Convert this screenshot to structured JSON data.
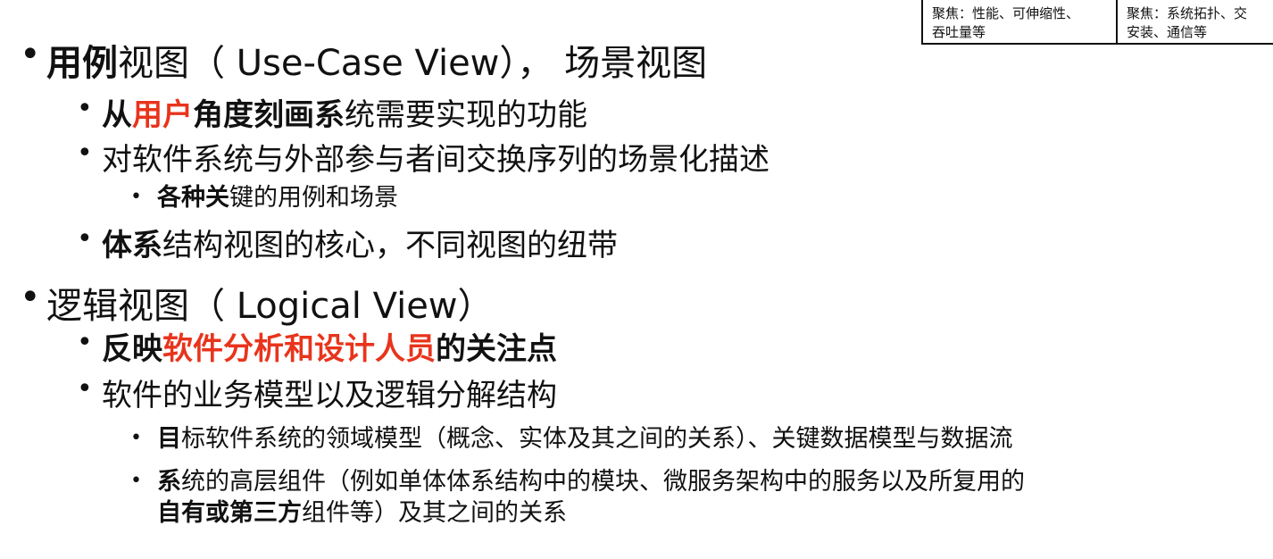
{
  "corner_table": {
    "cell1_line1": "聚焦：性能、可伸缩性、",
    "cell1_line2": "吞吐量等",
    "cell2_line1": "聚焦：系统拓扑、交",
    "cell2_line2": "安装、通信等"
  },
  "use_case": {
    "heading_bold": "用例",
    "heading_rest": "视图（ Use-Case View），  场景视图",
    "item1": {
      "p1": "从",
      "p2": "用户",
      "p3": "角度刻画系",
      "p4": "统需要实现的功能"
    },
    "item2": "对软件系统与外部参与者间交换序列的场景化描述",
    "item2_sub": {
      "bold": "各种关",
      "rest": "键的用例和场景"
    },
    "item3": {
      "bold": "体系",
      "rest": "结构视图的核心，不同视图的纽带"
    }
  },
  "logical": {
    "heading": "逻辑视图（ Logical View）",
    "item1": {
      "p1": "反映",
      "p2": "软件分析和设计人员",
      "p3": "的关注点"
    },
    "item2": "软件的业务模型以及逻辑分解结构",
    "sub1": {
      "bold": "目",
      "rest": "标软件系统的领域模型（概念、实体及其之间的关系）、关键数据模型与数据流"
    },
    "sub2_line1": {
      "bold": "系",
      "rest": "统的高层组件（例如单体体系结构中的模块、微服务架构中的服务以及所复用的"
    },
    "sub2_line2": {
      "bold": "自有或第三方",
      "rest": "组件等）及其之间的关系"
    }
  }
}
